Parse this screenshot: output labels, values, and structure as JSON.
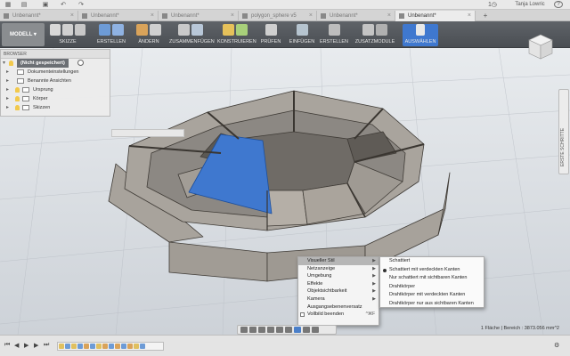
{
  "appbar": {
    "user": "Tanja Lowric",
    "help": "?",
    "clock": "1"
  },
  "tabs": [
    {
      "label": "Unbenannt*",
      "close": "×"
    },
    {
      "label": "Unbenannt*",
      "close": "×"
    },
    {
      "label": "Unbenannt*",
      "close": "×"
    },
    {
      "label": "polygon_sphere v5",
      "close": "×"
    },
    {
      "label": "Unbenannt*",
      "close": "×"
    },
    {
      "label": "Unbenannt*",
      "close": "×"
    }
  ],
  "toolbar": {
    "mode": "MODELL",
    "groups": [
      "SKIZZE",
      "ERSTELLEN",
      "ÄNDERN",
      "ZUSAMMENFÜGEN",
      "KONSTRUIEREN",
      "PRÜFEN",
      "EINFÜGEN",
      "ERSTELLEN",
      "ZUSATZMODULE",
      "AUSWÄHLEN"
    ]
  },
  "browser": {
    "title": "BROWSER",
    "root": "(Nicht gespeichert)",
    "items": [
      "Dokumenteinstellungen",
      "Benannte Ansichten",
      "Ursprung",
      "Körper",
      "Skizzen"
    ]
  },
  "side_panel": {
    "label": "ERSTE SCHRITTE"
  },
  "context_menu": {
    "items": [
      {
        "label": "Visueller Stil",
        "submenu": true
      },
      {
        "label": "Netzanzeige",
        "submenu": true
      },
      {
        "label": "Umgebung",
        "submenu": true
      },
      {
        "label": "Effekte",
        "submenu": true
      },
      {
        "label": "Objektsichtbarkeit",
        "submenu": true
      },
      {
        "label": "Kamera",
        "submenu": true
      },
      {
        "label": "Ausgangsebenenversatz",
        "submenu": false
      },
      {
        "label": "Vollbild beenden",
        "shortcut": "^⌘F",
        "checkbox": true
      }
    ],
    "submenu_items": [
      {
        "label": "Schattiert",
        "selected": false
      },
      {
        "label": "Schattiert mit verdeckten Kanten",
        "selected": true
      },
      {
        "label": "Nur schattiert mit sichtbaren Kanten",
        "selected": false
      },
      {
        "label": "Drahtkörper",
        "selected": false
      },
      {
        "label": "Drahtkörper mit verdeckten Kanten",
        "selected": false
      },
      {
        "label": "Drahtkörper nur aus sichtbaren Kanten",
        "selected": false
      }
    ]
  },
  "status": "1 Fläche | Bereich : 3873.056 mm^2",
  "colors": {
    "selected_face": "#3f78cf",
    "model_face": "#8e8b86",
    "toolbar_bg": "#54585d"
  }
}
